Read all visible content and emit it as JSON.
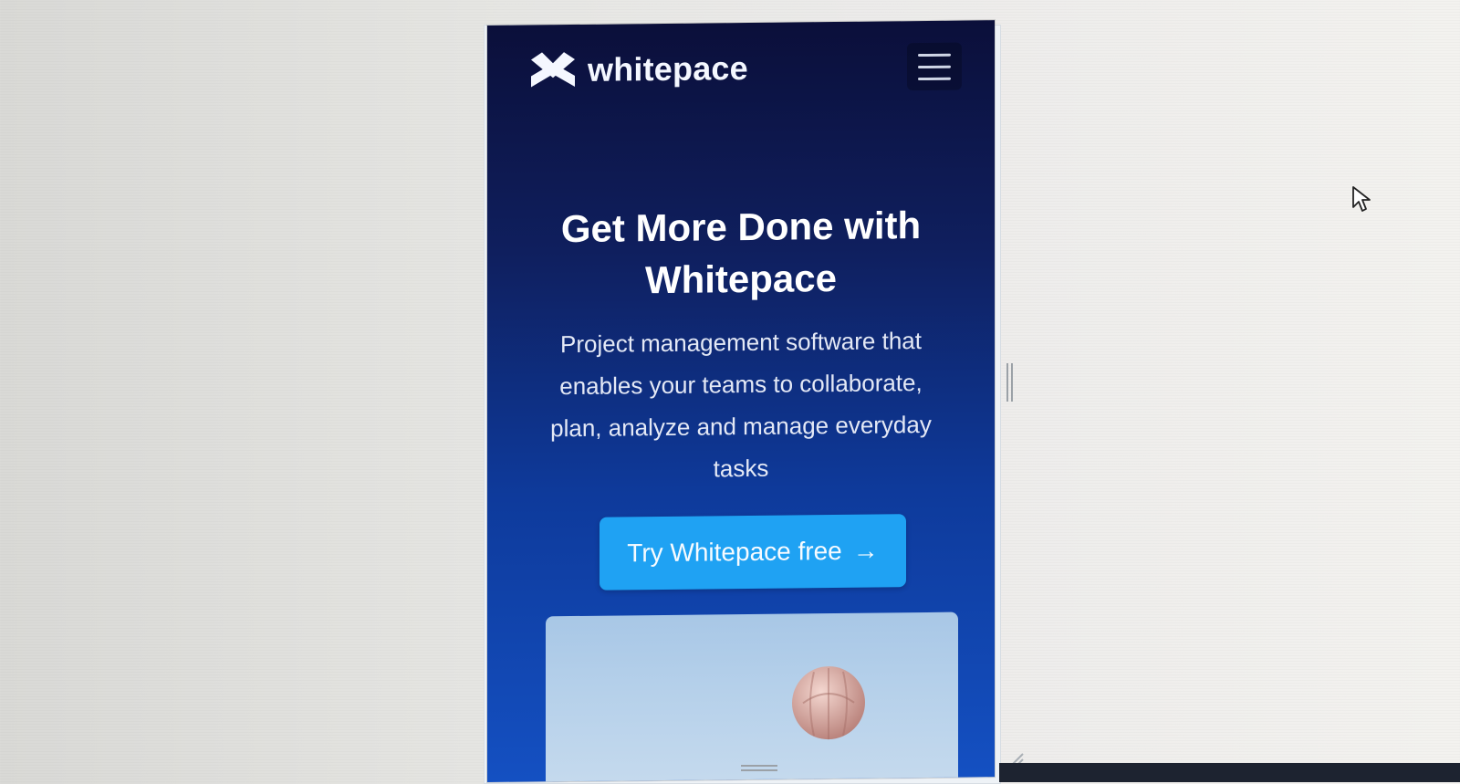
{
  "header": {
    "logo_text": "whitepace",
    "logo_icon": "whitepace-logo-icon",
    "menu_icon": "hamburger-menu-icon"
  },
  "hero": {
    "title": "Get More Done with Whitepace",
    "subtitle": "Project management software that enables your teams to collaborate, plan, analyze and manage everyday tasks",
    "cta_label": "Try Whitepace free",
    "cta_arrow": "→",
    "image_icon": "hot-air-balloon-icon"
  },
  "colors": {
    "hero_top": "#0b0f3a",
    "hero_bottom": "#1450c2",
    "cta": "#1fa2f3",
    "text": "#ffffff"
  }
}
